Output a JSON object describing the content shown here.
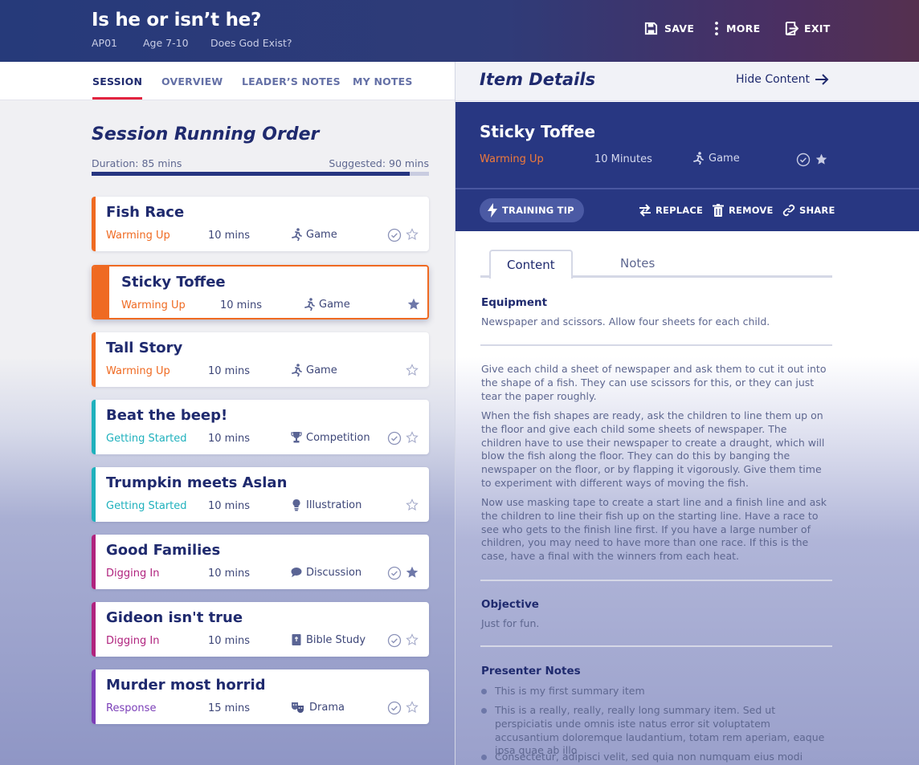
{
  "header": {
    "title": "Is he or isn’t he?",
    "code": "AP01",
    "age": "Age  7-10",
    "series": "Does God Exist?",
    "save_label": "SAVE",
    "more_label": "MORE",
    "exit_label": "EXIT"
  },
  "left_tabs": [
    "SESSION",
    "OVERVIEW",
    "LEADER’S NOTES",
    "MY NOTES"
  ],
  "running_order": {
    "title": "Session Running Order",
    "duration": "Duration: 85 mins",
    "suggested": "Suggested: 90 mins",
    "progress_fraction": 0.944
  },
  "items": [
    {
      "name": "Fish Race",
      "category": "Warming Up",
      "duration": "10 mins",
      "type": "Game",
      "checked": true,
      "starred": false
    },
    {
      "name": "Sticky Toffee",
      "category": "Warming Up",
      "duration": "10 mins",
      "type": "Game",
      "checked": false,
      "starred": true,
      "selected": true
    },
    {
      "name": "Tall Story",
      "category": "Warming Up",
      "duration": "10 mins",
      "type": "Game",
      "checked": false,
      "starred": false
    },
    {
      "name": "Beat the beep!",
      "category": "Getting Started",
      "duration": "10 mins",
      "type": "Competition",
      "checked": true,
      "starred": false
    },
    {
      "name": "Trumpkin meets Aslan",
      "category": "Getting Started",
      "duration": "10 mins",
      "type": "Illustration",
      "checked": false,
      "starred": false
    },
    {
      "name": "Good Families",
      "category": "Digging In",
      "duration": "10 mins",
      "type": "Discussion",
      "checked": true,
      "starred": true
    },
    {
      "name": "Gideon isn't true",
      "category": "Digging In",
      "duration": "10 mins",
      "type": "Bible Study",
      "checked": true,
      "starred": false
    },
    {
      "name": "Murder most horrid",
      "category": "Response",
      "duration": "15 mins",
      "type": "Drama",
      "checked": true,
      "starred": false
    }
  ],
  "category_colors": {
    "Warming Up": "#ef6a22",
    "Getting Started": "#1fb1bd",
    "Digging In": "#b0237e",
    "Response": "#7b3fb8"
  },
  "details": {
    "title": "Item Details",
    "hide_label": "Hide Content",
    "name": "Sticky Toffee",
    "category": "Warming Up",
    "duration": "10 Minutes",
    "type": "Game",
    "training_tip_label": "TRAINING TIP",
    "replace_label": "REPLACE",
    "remove_label": "REMOVE",
    "share_label": "SHARE",
    "tab_content": "Content",
    "tab_notes": "Notes",
    "equipment_heading": "Equipment",
    "equipment_text": "Newspaper and scissors. Allow four sheets for each child.",
    "para1": "Give each child a sheet of newspaper and ask them to cut it out into the shape of a fish. They can use scissors for this, or they can just tear the paper roughly.",
    "para2": "When the fish shapes are ready, ask the children to line them up on the floor and give each child some sheets of newspaper. The children have to use their newspaper to create a draught, which will blow the fish along the floor. They can do this by banging the newspaper on the floor, or by flapping it vigorously. Give them time to experiment with different ways of moving the fish.",
    "para3": "Now use masking tape to create a start line and a finish line and ask the children to line their fish up on the starting line. Have a race to see who gets to the finish line first. If you have a large number of children, you may need to have more than one race. If this is the case, have a final with the winners from each heat.",
    "objective_heading": "Objective",
    "objective_text": "Just for fun.",
    "presenter_heading": "Presenter Notes",
    "notes": [
      "This is my first summary item",
      "This is a really, really, really long summary item. Sed ut perspiciatis unde omnis iste natus error sit voluptatem accusantium doloremque laudantium, totam rem aperiam, eaque ipsa quae ab illo",
      "Consectetur, adipisci velit, sed quia non numquam eius modi"
    ]
  }
}
